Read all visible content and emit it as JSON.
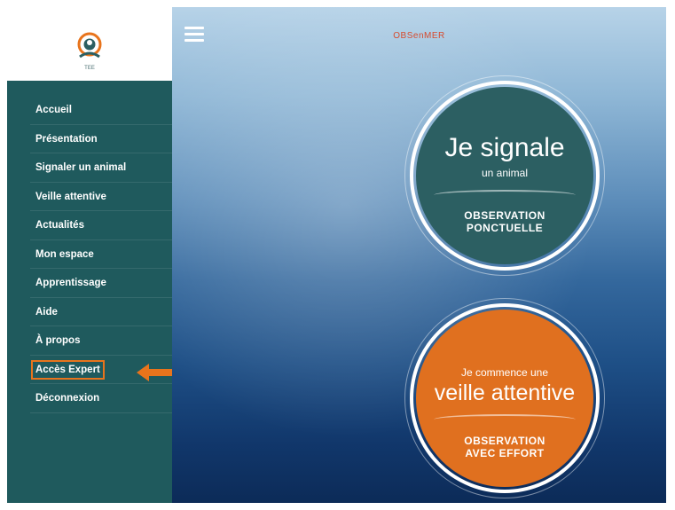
{
  "logo": {
    "caption": "TEE"
  },
  "menu": [
    {
      "label": "Accueil"
    },
    {
      "label": "Présentation"
    },
    {
      "label": "Signaler un animal"
    },
    {
      "label": "Veille attentive"
    },
    {
      "label": "Actualités"
    },
    {
      "label": "Mon espace"
    },
    {
      "label": "Apprentissage"
    },
    {
      "label": "Aide"
    },
    {
      "label": "À propos"
    },
    {
      "label": "Accès Expert"
    },
    {
      "label": "Déconnexion"
    }
  ],
  "header": {
    "title": "OBSenMER"
  },
  "actions": {
    "signal": {
      "big": "Je signale",
      "small": "un animal",
      "type_line1": "OBSERVATION",
      "type_line2": "PONCTUELLE",
      "color": "#2c5f62"
    },
    "watch": {
      "small": "Je commence une",
      "big": "veille attentive",
      "type_line1": "OBSERVATION",
      "type_line2": "AVEC EFFORT",
      "color": "#e0701f"
    }
  },
  "colors": {
    "sidebar": "#1f5a5d",
    "accent": "#e8741c",
    "title": "#d64b2e"
  },
  "icons": [
    "logo-icon",
    "hamburger-icon",
    "arrow-left-icon"
  ]
}
